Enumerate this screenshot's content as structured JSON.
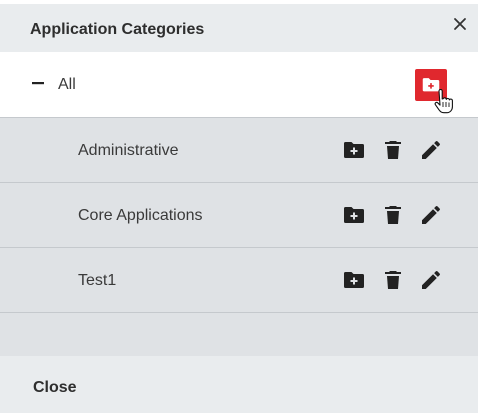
{
  "dialog": {
    "title": "Application Categories",
    "close_label": "Close"
  },
  "root": {
    "label": "All"
  },
  "categories": [
    {
      "label": "Administrative"
    },
    {
      "label": "Core Applications"
    },
    {
      "label": "Test1"
    }
  ],
  "colors": {
    "accent": "#e0282e",
    "header_bg": "#e9ecee",
    "row_bg": "#dfe2e5",
    "icon": "#222222"
  },
  "icons": {
    "close": "close-icon",
    "collapse": "minus-icon",
    "add_folder": "folder-plus-icon",
    "delete": "trash-icon",
    "edit": "pencil-icon"
  }
}
